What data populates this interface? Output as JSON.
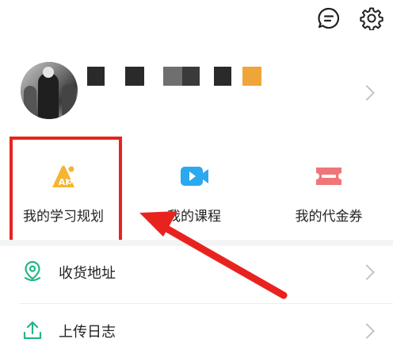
{
  "header": {
    "chat_icon": "message-bubble-icon",
    "settings_icon": "gear-icon"
  },
  "profile": {
    "avatar": "avatar-photo"
  },
  "quick_actions": [
    {
      "label": "我的学习规划",
      "icon": "ai-plan-icon",
      "accent": "#f5b52e"
    },
    {
      "label": "我的课程",
      "icon": "video-course-icon",
      "accent": "#2aa8f0"
    },
    {
      "label": "我的代金券",
      "icon": "ticket-voucher-icon",
      "accent": "#ef7678"
    }
  ],
  "list": [
    {
      "label": "收货地址",
      "icon": "location-pin-icon"
    },
    {
      "label": "上传日志",
      "icon": "upload-icon"
    }
  ],
  "colors": {
    "brand_green": "#22b58a",
    "highlight_red": "#e8231f"
  }
}
